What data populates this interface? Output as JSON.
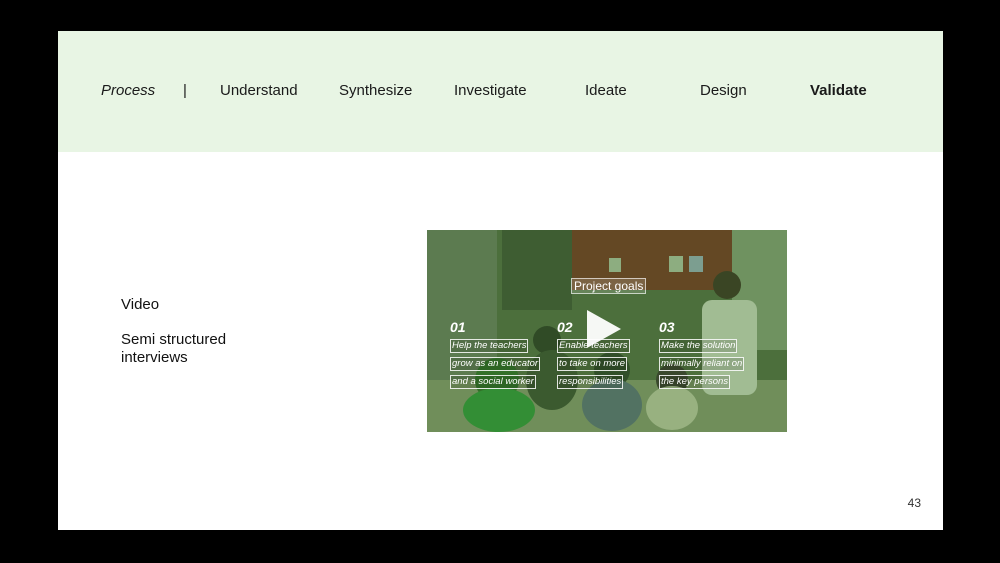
{
  "nav": {
    "process_label": "Process",
    "separator": "|",
    "items": [
      {
        "label": "Understand",
        "active": false
      },
      {
        "label": "Synthesize",
        "active": false
      },
      {
        "label": "Investigate",
        "active": false
      },
      {
        "label": "Ideate",
        "active": false
      },
      {
        "label": "Design",
        "active": false
      },
      {
        "label": "Validate",
        "active": true
      }
    ]
  },
  "content": {
    "methods": [
      "Video",
      "Semi structured",
      "interviews"
    ]
  },
  "video": {
    "overlay_title": "Project goals",
    "goals": [
      {
        "num": "01",
        "lines": [
          "Help the teachers",
          "grow as an educator",
          "and a social worker"
        ]
      },
      {
        "num": "02",
        "lines": [
          "Enable teachers",
          "to take on more",
          "responsibilities"
        ]
      },
      {
        "num": "03",
        "lines": [
          "Make the solution",
          "minimally reliant on",
          "the key persons"
        ]
      }
    ],
    "play_icon": "play-icon"
  },
  "footer": {
    "page_number": "43"
  },
  "colors": {
    "header_bg": "#e8f5e4",
    "slide_bg": "#ffffff",
    "frame_bg": "#000000",
    "video_tint": "#3c7828"
  }
}
